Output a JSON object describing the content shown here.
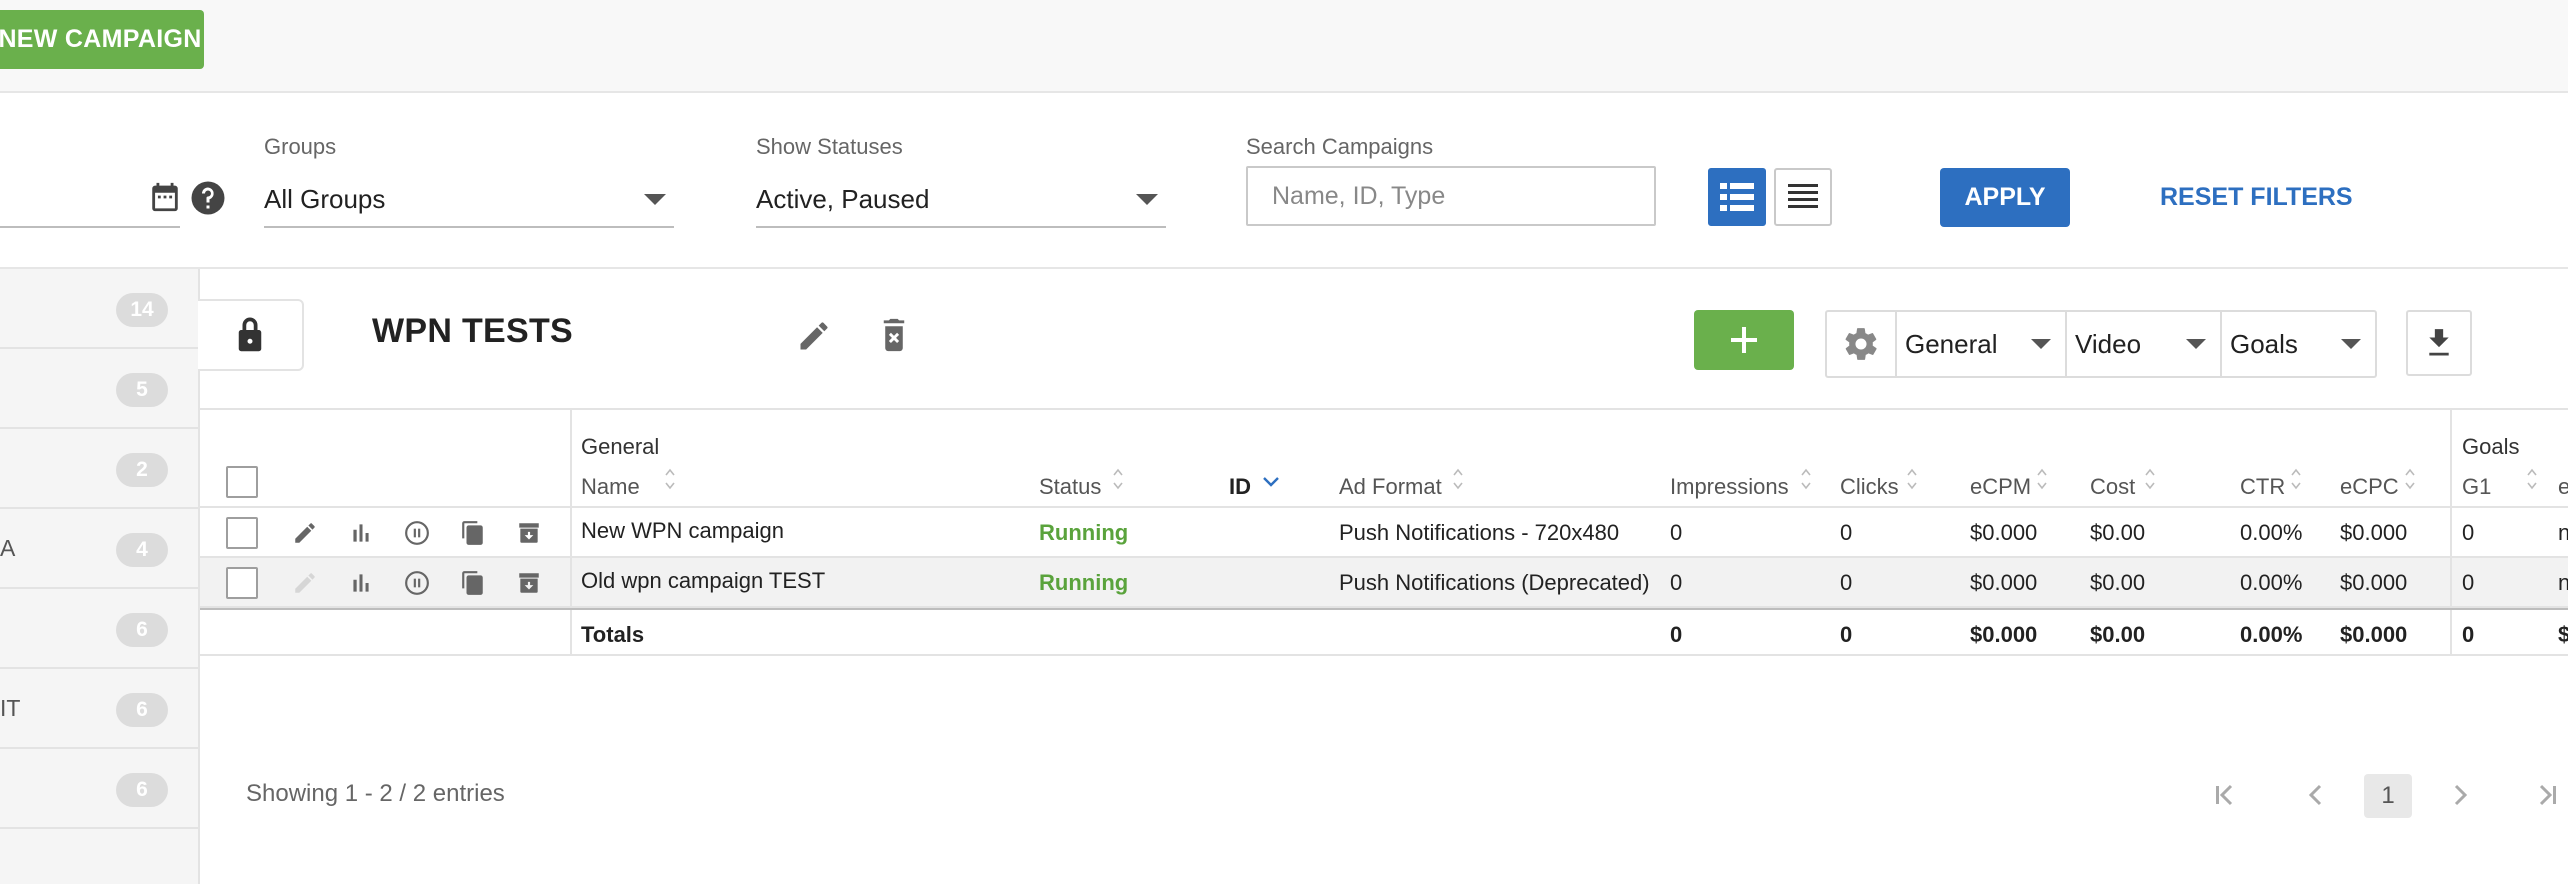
{
  "toolbar": {
    "new_campaign_label": "NEW CAMPAIGN"
  },
  "filters": {
    "groups": {
      "label": "Groups",
      "value": "All Groups"
    },
    "statuses": {
      "label": "Show Statuses",
      "value": "Active, Paused"
    },
    "search": {
      "label": "Search Campaigns",
      "placeholder": "Name, ID, Type"
    },
    "apply_label": "APPLY",
    "reset_label": "RESET FILTERS"
  },
  "sidebar": {
    "groups": [
      {
        "label": "",
        "count": "14"
      },
      {
        "label": "",
        "count": "5"
      },
      {
        "label": "",
        "count": "2"
      },
      {
        "label": "A",
        "count": "4"
      },
      {
        "label": "",
        "count": "6"
      },
      {
        "label": "IT",
        "count": "6"
      },
      {
        "label": "",
        "count": "6"
      }
    ]
  },
  "group": {
    "title": "WPN TESTS",
    "column_sets": [
      "General",
      "Video",
      "Goals"
    ]
  },
  "table": {
    "group_headers": {
      "general": "General",
      "goals": "Goals"
    },
    "columns": {
      "name": "Name",
      "status": "Status",
      "id": "ID",
      "ad_format": "Ad Format",
      "impressions": "Impressions",
      "clicks": "Clicks",
      "ecpm": "eCPM",
      "cost": "Cost",
      "ctr": "CTR",
      "ecpc": "eCPC",
      "g1": "G1",
      "e": "e"
    },
    "rows": [
      {
        "name": "New WPN campaign",
        "status": "Running",
        "id": "",
        "ad_format": "Push Notifications - 720x480",
        "impressions": "0",
        "clicks": "0",
        "ecpm": "$0.000",
        "cost": "$0.00",
        "ctr": "0.00%",
        "ecpc": "$0.000",
        "g1": "0",
        "e": "n"
      },
      {
        "name": "Old wpn campaign TEST",
        "status": "Running",
        "id": "",
        "ad_format": "Push Notifications (Deprecated)",
        "impressions": "0",
        "clicks": "0",
        "ecpm": "$0.000",
        "cost": "$0.00",
        "ctr": "0.00%",
        "ecpc": "$0.000",
        "g1": "0",
        "e": "n"
      }
    ],
    "totals": {
      "label": "Totals",
      "impressions": "0",
      "clicks": "0",
      "ecpm": "$0.000",
      "cost": "$0.00",
      "ctr": "0.00%",
      "ecpc": "$0.000",
      "g1": "0",
      "e": "$"
    }
  },
  "pagination": {
    "showing": "Showing 1 - 2 / 2 entries",
    "current_page": "1"
  },
  "colors": {
    "green": "#6ab04c",
    "blue": "#2d6fc0",
    "running": "#5aa33c"
  }
}
